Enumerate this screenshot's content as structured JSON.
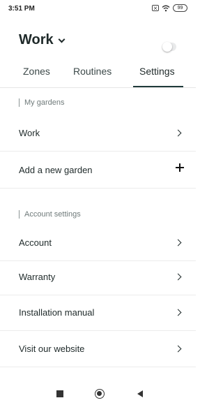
{
  "status_bar": {
    "time": "3:51 PM",
    "battery": "99"
  },
  "header": {
    "garden_name": "Work"
  },
  "tabs": [
    {
      "label": "Zones"
    },
    {
      "label": "Routines"
    },
    {
      "label": "Settings"
    }
  ],
  "my_gardens": {
    "header": "My gardens",
    "items": [
      {
        "label": "Work"
      }
    ],
    "add_label": "Add a new garden"
  },
  "account_settings": {
    "header": "Account settings",
    "items": [
      {
        "label": "Account"
      },
      {
        "label": "Warranty"
      },
      {
        "label": "Installation manual"
      },
      {
        "label": "Visit our website"
      }
    ]
  }
}
